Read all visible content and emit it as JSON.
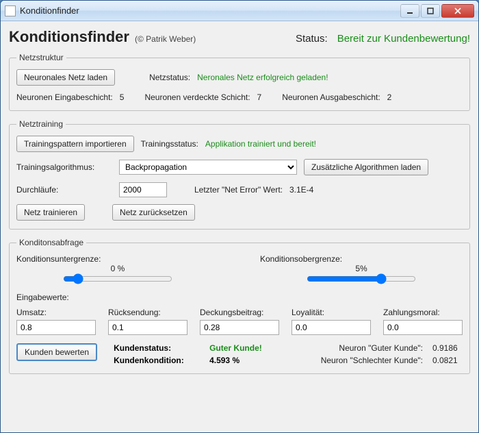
{
  "titlebar": {
    "title": "Konditionfinder"
  },
  "header": {
    "app_title": "Konditionsfinder",
    "copyright": "(© Patrik Weber)",
    "status_label": "Status:",
    "status_value": "Bereit zur Kundenbewertung!"
  },
  "netstructure": {
    "legend": "Netzstruktur",
    "load_btn": "Neuronales Netz laden",
    "netstatus_label": "Netzstatus:",
    "netstatus_value": "Neronales Netz erfolgreich geladen!",
    "neurons_in_label": "Neuronen Eingabeschicht:",
    "neurons_in_value": "5",
    "neurons_hidden_label": "Neuronen verdeckte Schicht:",
    "neurons_hidden_value": "7",
    "neurons_out_label": "Neuronen Ausgabeschicht:",
    "neurons_out_value": "2"
  },
  "training": {
    "legend": "Netztraining",
    "import_btn": "Trainingspattern importieren",
    "trainstatus_label": "Trainingsstatus:",
    "trainstatus_value": "Applikation trainiert und bereit!",
    "algo_label": "Trainingsalgorithmus:",
    "algo_selected": "Backpropagation",
    "addalgo_btn": "Zusätzliche Algorithmen laden",
    "runs_label": "Durchläufe:",
    "runs_value": "2000",
    "lasterr_label": "Letzter \"Net Error\" Wert:",
    "lasterr_value": "3.1E-4",
    "train_btn": "Netz trainieren",
    "reset_btn": "Netz zurücksetzen"
  },
  "query": {
    "legend": "Konditonsabfrage",
    "lower_label": "Konditionsuntergrenze:",
    "lower_value": "0 %",
    "upper_label": "Konditionsobergrenze:",
    "upper_value": "5%",
    "inputs_label": "Eingabewerte:",
    "cols": {
      "umsatz_label": "Umsatz:",
      "umsatz_value": "0.8",
      "ruecksendung_label": "Rücksendung:",
      "ruecksendung_value": "0.1",
      "deckung_label": "Deckungsbeitrag:",
      "deckung_value": "0.28",
      "loyal_label": "Loyalität:",
      "loyal_value": "0.0",
      "zahlung_label": "Zahlungsmoral:",
      "zahlung_value": "0.0"
    },
    "evaluate_btn": "Kunden bewerten",
    "kundenstatus_label": "Kundenstatus:",
    "kundenstatus_value": "Guter Kunde!",
    "kondition_label": "Kundenkondition:",
    "kondition_value": "4.593 %",
    "neuron_good_label": "Neuron \"Guter Kunde\":",
    "neuron_good_value": "0.9186",
    "neuron_bad_label": "Neuron \"Schlechter Kunde\":",
    "neuron_bad_value": "0.0821"
  }
}
